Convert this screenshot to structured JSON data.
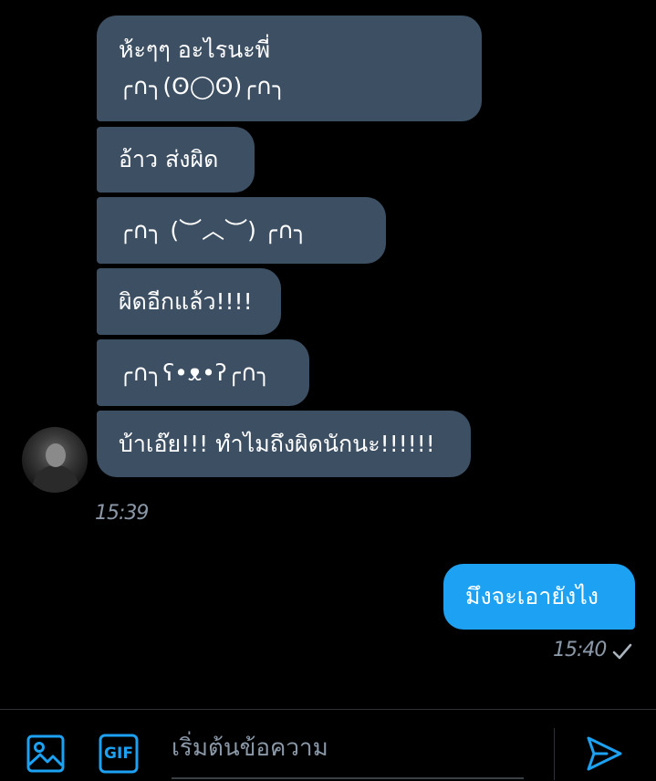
{
  "messages": {
    "incoming": [
      {
        "text": "ห้ะๆๆ อะไรนะพี่\n╭∩╮(ʘ◯ʘ)╭∩╮"
      },
      {
        "text": "อ้าว ส่งผิด"
      },
      {
        "text": "╭∩╮ (︶︿︶) ╭∩╮"
      },
      {
        "text": "ผิดอีกแล้ว!!!!"
      },
      {
        "text": "╭∩╮ʕ•ᴥ•ʔ╭∩╮"
      },
      {
        "text": "บ้าเอ๊ย!!! ทำไมถึงผิดนักนะ!!!!!!"
      }
    ],
    "incoming_time": "15:39",
    "outgoing": {
      "text": "มึงจะเอายังไง",
      "time": "15:40"
    }
  },
  "composer": {
    "placeholder": "เริ่มต้นข้อความ",
    "gif_label": "GIF"
  },
  "colors": {
    "incoming_bubble": "#3d4f63",
    "outgoing_bubble": "#1da1f2",
    "accent": "#1da1f2",
    "background": "#000000",
    "muted_text": "#8a98a8"
  },
  "icons": [
    "image-icon",
    "gif-icon",
    "send-icon",
    "read-check-icon",
    "avatar"
  ]
}
